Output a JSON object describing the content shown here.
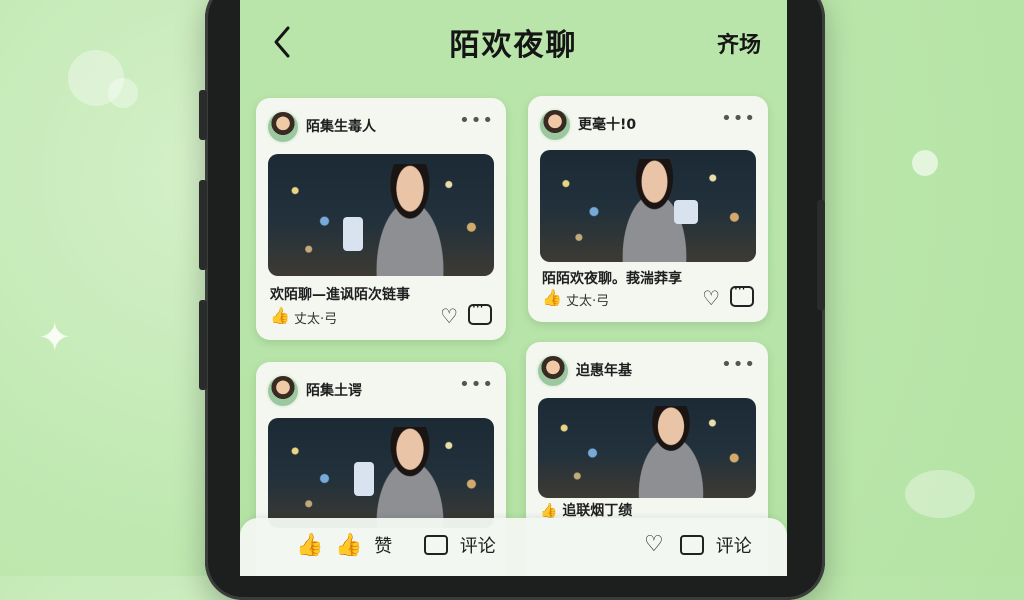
{
  "header": {
    "title": "陌欢夜聊",
    "action_label": "齐场"
  },
  "feed": [
    {
      "username": "陌集生毒人",
      "caption": "欢陌聊—進讽陌次链事",
      "likes_label": "丈太·弓"
    },
    {
      "username": "更毫十!0",
      "caption": "陌陌欢夜聊。莪湍莽享",
      "likes_label": "丈太·弓"
    },
    {
      "username": "陌集土谔",
      "caption": "",
      "likes_label": ""
    },
    {
      "username": "迫惠年基",
      "caption": "追联烟丁绩",
      "likes_label": ""
    }
  ],
  "bottombar": {
    "like_label": "赞",
    "comment_label_left": "评论",
    "comment_label_right": "评论"
  },
  "colors": {
    "background": "#b9e5ab",
    "card": "#f3f7f0",
    "text": "#151515"
  },
  "icons": [
    "back-icon",
    "more-icon",
    "thumb-up-icon",
    "heart-icon",
    "comment-icon"
  ]
}
